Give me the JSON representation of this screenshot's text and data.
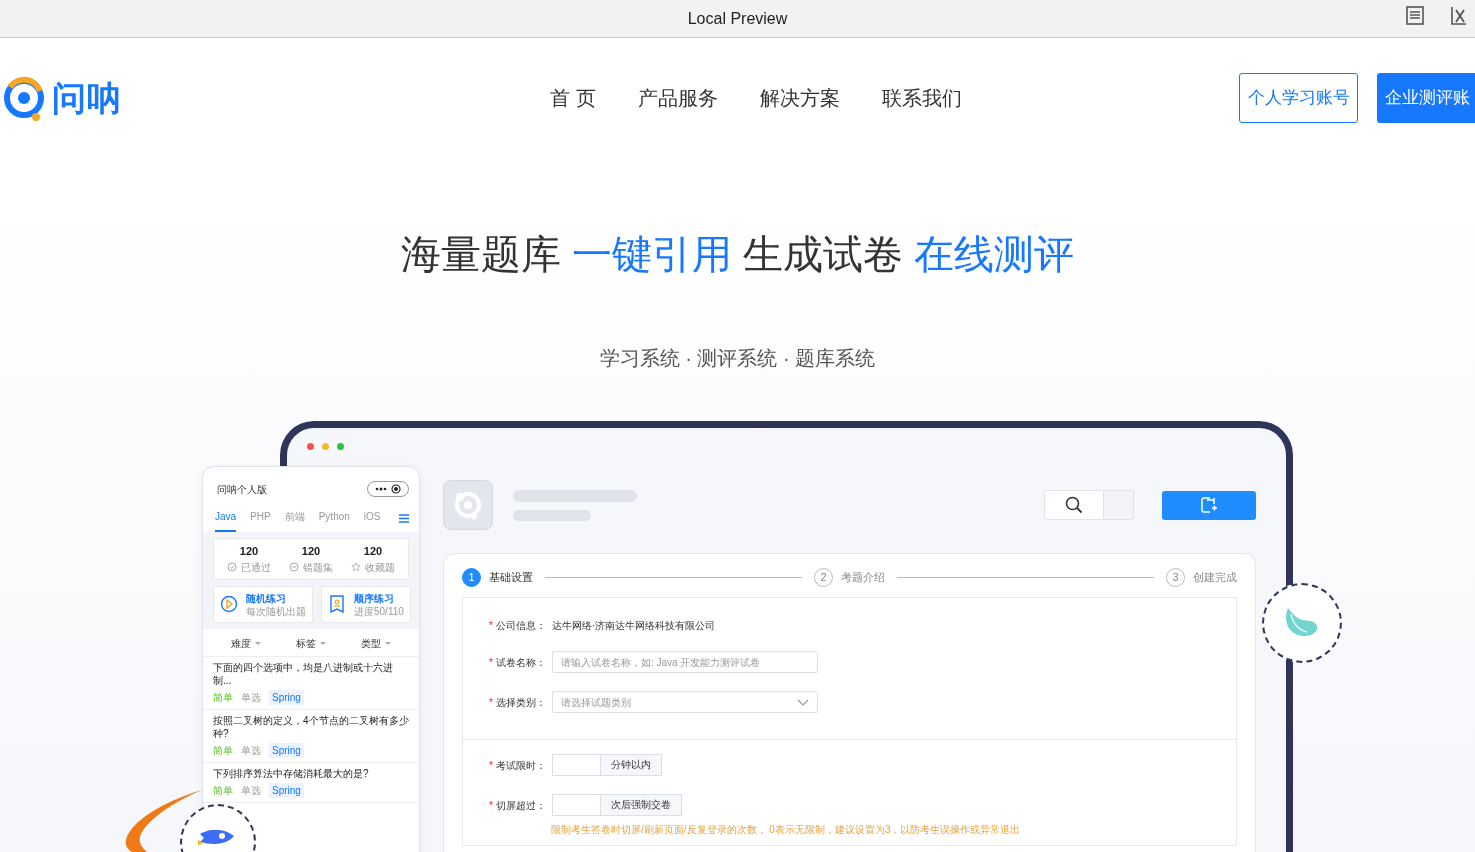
{
  "window": {
    "title": "Local Preview"
  },
  "site": {
    "logo": "问呐",
    "nav": [
      {
        "label": "首 页"
      },
      {
        "label": "产品服务"
      },
      {
        "label": "解决方案"
      },
      {
        "label": "联系我们"
      }
    ],
    "buttons": [
      {
        "label": "个人学习账号",
        "kind": "outline"
      },
      {
        "label": "企业测评账",
        "kind": "solid"
      }
    ]
  },
  "hero": {
    "title": [
      {
        "text": "海量题库",
        "highlight": false
      },
      {
        "text": "一键引用",
        "highlight": true
      },
      {
        "text": "生成试卷",
        "highlight": false
      },
      {
        "text": "在线测评",
        "highlight": true
      }
    ],
    "subtitle": "学习系统 · 测评系统 · 题库系统"
  },
  "phone": {
    "title": "问呐个人版",
    "tabs": [
      {
        "label": "Java",
        "selected": true
      },
      {
        "label": "PHP",
        "selected": false
      },
      {
        "label": "前端",
        "selected": false
      },
      {
        "label": "Python",
        "selected": false
      },
      {
        "label": "iOS",
        "selected": false
      }
    ],
    "stats": [
      {
        "value": "120",
        "label": "已通过",
        "kind": "check"
      },
      {
        "value": "120",
        "label": "错题集",
        "kind": "minus"
      },
      {
        "value": "120",
        "label": "收藏题",
        "kind": "star"
      }
    ],
    "practice": [
      {
        "title": "随机练习",
        "subtitle": "每次随机出题",
        "kind": "random"
      },
      {
        "title": "顺序练习",
        "subtitle": "进度50/110",
        "kind": "order"
      }
    ],
    "filters": [
      "难度",
      "标签",
      "类型"
    ],
    "questions": [
      {
        "text": "下面的四个选项中，均是八进制或十六进制...",
        "difficulty": "简单",
        "type": "单选",
        "tag": "Spring"
      },
      {
        "text": "按照二叉树的定义，4个节点的二叉树有多少种?",
        "difficulty": "简单",
        "type": "单选",
        "tag": "Spring"
      },
      {
        "text": "下列排序算法中存储消耗最大的是?",
        "difficulty": "简单",
        "type": "单选",
        "tag": "Spring"
      }
    ]
  },
  "desktop": {
    "steps": [
      {
        "number": "1",
        "label": "基础设置",
        "selected": true
      },
      {
        "number": "2",
        "label": "考题介绍",
        "selected": false
      },
      {
        "number": "3",
        "label": "创建完成",
        "selected": false
      }
    ],
    "fields": [
      {
        "kind": "text",
        "required_mark": "*",
        "label": "公司信息：",
        "value": "达牛网络·济南达牛网络科技有限公司"
      },
      {
        "kind": "input",
        "required_mark": "*",
        "label": "试卷名称：",
        "placeholder": "请输入试卷名称，如: Java 开发能力测评试卷"
      },
      {
        "kind": "select",
        "required_mark": "*",
        "label": "选择类别：",
        "placeholder": "请选择试题类别"
      }
    ],
    "limits": [
      {
        "required_mark": "*",
        "label": "考试限时：",
        "addon": "分钟以内"
      },
      {
        "required_mark": "*",
        "label": "切屏超过：",
        "addon": "次后强制交卷"
      }
    ],
    "hint": "限制考生答卷时切屏/刷新页面/反复登录的次数， 0表示无限制，建议设置为3，以防考生误操作或异常退出"
  }
}
